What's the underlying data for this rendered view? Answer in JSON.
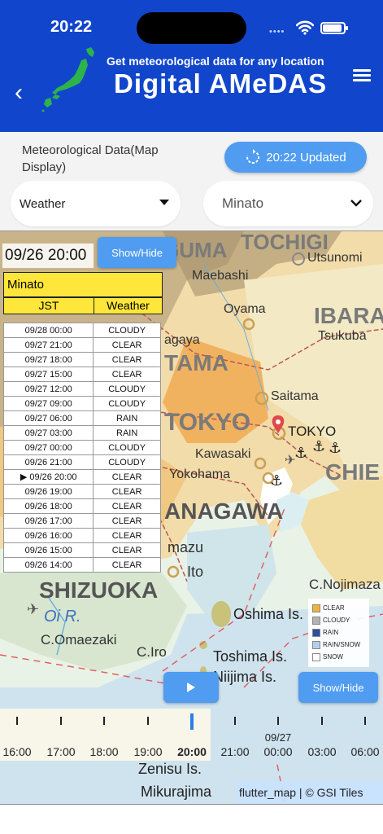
{
  "status_bar": {
    "time": "20:22",
    "signal_dots": "••••"
  },
  "header": {
    "subtitle": "Get meteorological data for any location",
    "title": "Digital AMeDAS",
    "back_glyph": "‹",
    "accent_color": "#1146cc"
  },
  "controls": {
    "section_label": "Meteorological Data(Map Display)",
    "updated_button": "20:22 Updated",
    "element_select": "Weather",
    "location_select": "Minato"
  },
  "map": {
    "datetime": "09/26 20:00",
    "show_hide_label": "Show/Hide",
    "place_labels": {
      "tochigi": "TOCHIGI",
      "utsunomiya": "Utsunomi",
      "gunma": "GUMA",
      "maebashi": "Maebashi",
      "oyama": "Oyama",
      "ibaraki": "IBARA",
      "tsukuba": "Tsukuba",
      "kumagaya": "agaya",
      "saitama_pref": "TAMA",
      "saitama": "Saitama",
      "tokyo_pref": "TOKYO",
      "tokyo": "TOKYO",
      "kawasaki": "Kawasaki",
      "yokohama": "Yokohama",
      "chiba": "CHIE",
      "kanagawa": "ANAGAWA",
      "numazu": "mazu",
      "ito": "Ito",
      "shizuoka": "SHIZUOKA",
      "oi_river": "Oi R.",
      "c_omaezaki": "C.Omaezaki",
      "c_iro": "C.Iro",
      "oshima": "Oshima Is.",
      "toshima": "Toshima Is.",
      "niijima": "Niijima Is.",
      "c_nojimazaki": "C.Nojimaza",
      "zenisu": "Zenisu Is.",
      "mikurajima": "Mikurajima"
    },
    "attribution": "flutter_map | © GSI Tiles"
  },
  "station": {
    "name": "Minato",
    "columns": [
      "JST",
      "Weather"
    ],
    "rows": [
      {
        "time": "09/28 00:00",
        "weather": "CLOUDY",
        "marker": ""
      },
      {
        "time": "09/27 21:00",
        "weather": "CLEAR",
        "marker": ""
      },
      {
        "time": "09/27 18:00",
        "weather": "CLEAR",
        "marker": ""
      },
      {
        "time": "09/27 15:00",
        "weather": "CLEAR",
        "marker": ""
      },
      {
        "time": "09/27 12:00",
        "weather": "CLOUDY",
        "marker": ""
      },
      {
        "time": "09/27 09:00",
        "weather": "CLOUDY",
        "marker": ""
      },
      {
        "time": "09/27 06:00",
        "weather": "RAIN",
        "marker": ""
      },
      {
        "time": "09/27 03:00",
        "weather": "RAIN",
        "marker": ""
      },
      {
        "time": "09/27 00:00",
        "weather": "CLOUDY",
        "marker": ""
      },
      {
        "time": "09/26 21:00",
        "weather": "CLOUDY",
        "marker": ""
      },
      {
        "time": "09/26 20:00",
        "weather": "CLEAR",
        "marker": "▶ "
      },
      {
        "time": "09/26 19:00",
        "weather": "CLEAR",
        "marker": ""
      },
      {
        "time": "09/26 18:00",
        "weather": "CLEAR",
        "marker": ""
      },
      {
        "time": "09/26 17:00",
        "weather": "CLEAR",
        "marker": ""
      },
      {
        "time": "09/26 16:00",
        "weather": "CLEAR",
        "marker": ""
      },
      {
        "time": "09/26 15:00",
        "weather": "CLEAR",
        "marker": ""
      },
      {
        "time": "09/26 14:00",
        "weather": "CLEAR",
        "marker": ""
      }
    ]
  },
  "legend": {
    "items": [
      {
        "label": "CLEAR",
        "color": "#f2b33d"
      },
      {
        "label": "CLOUDY",
        "color": "#b3b3b3"
      },
      {
        "label": "RAIN",
        "color": "#2c4f9c"
      },
      {
        "label": "RAIN/SNOW",
        "color": "#b6d0ea"
      },
      {
        "label": "SNOW",
        "color": "#ffffff"
      }
    ]
  },
  "timeline": {
    "show_hide_label": "Show/Hide",
    "date_marker": "09/27",
    "labels": [
      {
        "text": "16:00",
        "current": false
      },
      {
        "text": "17:00",
        "current": false
      },
      {
        "text": "18:00",
        "current": false
      },
      {
        "text": "19:00",
        "current": false
      },
      {
        "text": "20:00",
        "current": true
      },
      {
        "text": "21:00",
        "current": false
      },
      {
        "text": "00:00",
        "current": false
      },
      {
        "text": "03:00",
        "current": false
      },
      {
        "text": "06:00",
        "current": false
      }
    ]
  }
}
